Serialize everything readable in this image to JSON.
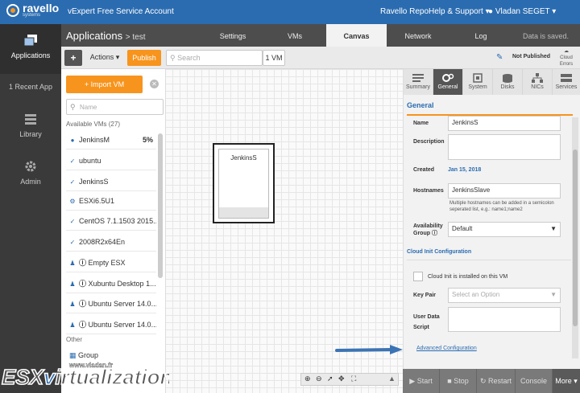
{
  "topbar": {
    "brand": "ravello",
    "brand_sub": "systems",
    "account": "vExpert Free Service Account",
    "repo": "Ravello Repo",
    "help": "Help & Support",
    "user": "Vladan SEGET"
  },
  "sidebar": {
    "items": [
      {
        "label": "Applications"
      },
      {
        "label": "1 Recent App"
      },
      {
        "label": "Library"
      },
      {
        "label": "Admin"
      }
    ]
  },
  "header": {
    "title": "Applications",
    "crumb": "> test",
    "tabs": [
      "Settings",
      "VMs",
      "Canvas",
      "Network",
      "Log"
    ],
    "saved": "Data is saved."
  },
  "toolbar": {
    "add": "+",
    "actions": "Actions",
    "publish": "Publish",
    "search_placeholder": "Search",
    "vm_count": "1 VM",
    "status": "Not Published",
    "cloud_errors": "Cloud Errors"
  },
  "vmpanel": {
    "import": "Import VM",
    "name_placeholder": "Name",
    "available": "Available VMs (27)",
    "rows": [
      {
        "name": "JenkinsM",
        "pct": "5%"
      },
      {
        "name": "ubuntu"
      },
      {
        "name": "JenkinsS"
      },
      {
        "name": "ESXi6.5U1"
      },
      {
        "name": "CentOS 7.1.1503 2015..."
      },
      {
        "name": "2008R2x64En"
      },
      {
        "name": "Empty ESX"
      },
      {
        "name": "Xubuntu Desktop 1..."
      },
      {
        "name": "Ubuntu Server 14.0..."
      },
      {
        "name": "Ubuntu Server 14.0..."
      }
    ],
    "other": "Other",
    "group": "Group"
  },
  "canvas": {
    "node_name": "JenkinsS"
  },
  "rpanel": {
    "tabs": [
      "Summary",
      "General",
      "System",
      "Disks",
      "NICs",
      "Services"
    ],
    "section": "General",
    "fields": {
      "name_label": "Name",
      "name_value": "JenkinsS",
      "desc_label": "Description",
      "created_label": "Created",
      "created_value": "Jan 15, 2018",
      "host_label": "Hostnames",
      "host_value": "JenkinsSlave",
      "host_hint": "Multiple hostnames can be added in a semicolon seperated list, e.g.: name1;name2",
      "avail_label": "Availability",
      "avail_label2": "Group",
      "avail_value": "Default"
    },
    "cloud_init": "Cloud Init Configuration",
    "cloud_check": "Cloud Init is installed on this VM",
    "keypair_label": "Key Pair",
    "keypair_value": "Select an Option",
    "userdata_label": "User Data",
    "script_label": "Script",
    "advanced": "Advanced Configuration"
  },
  "actions": [
    "Start",
    "Stop",
    "Restart",
    "Console",
    "More"
  ],
  "watermark": {
    "logo": "ESXvirtualization",
    "url": "www.vladan.fr"
  },
  "colors": {
    "brand": "#2b6cb0",
    "accent": "#f7941d"
  }
}
